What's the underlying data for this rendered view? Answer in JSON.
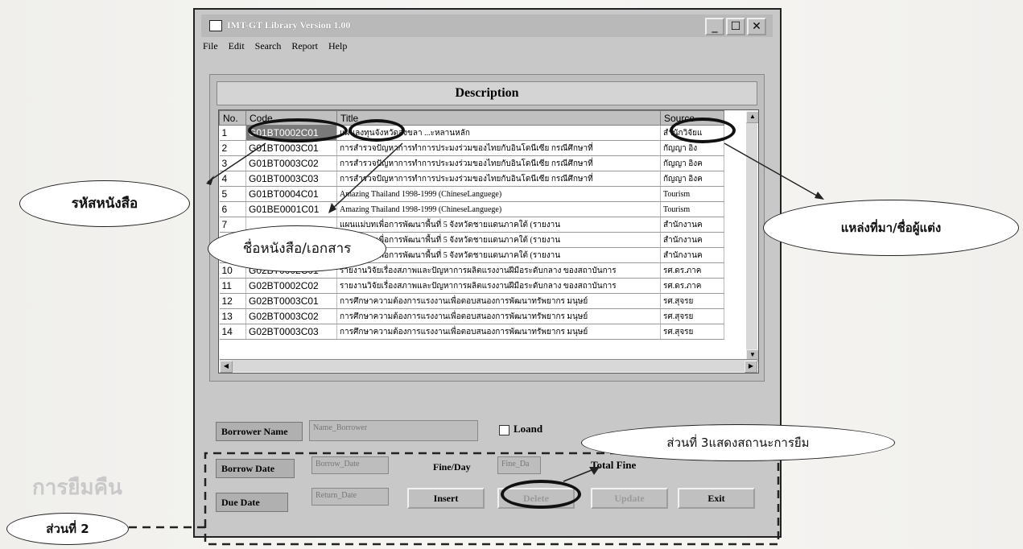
{
  "window": {
    "title": "IMT-GT Library Version 1.00",
    "controls": {
      "minimize": "_",
      "maximize": "☐",
      "close": "✕"
    }
  },
  "menu": [
    "File",
    "Edit",
    "Search",
    "Report",
    "Help"
  ],
  "panel": {
    "header": "Description",
    "columns": [
      "No.",
      "Code",
      "Title",
      "Source"
    ],
    "rows": [
      {
        "no": "1",
        "code": "G01BT0002C01",
        "title": "แผนลงทุนจังหวัดสงขลา  ...ะหลานหลัก",
        "source": "สำนักวิจัยแ"
      },
      {
        "no": "2",
        "code": "G01BT0003C01",
        "title": "การสำรวจปัญหาการทำการประมงร่วมของไทยกับอินโดนีเซีย กรณีศึกษาที่",
        "source": "กัญญา อิง"
      },
      {
        "no": "3",
        "code": "G01BT0003C02",
        "title": "การสำรวจปัญหาการทำการประมงร่วมของไทยกับอินโดนีเซีย กรณีศึกษาที่",
        "source": "กัญญา อิงค"
      },
      {
        "no": "4",
        "code": "G01BT0003C03",
        "title": "การสำรวจปัญหาการทำการประมงร่วมของไทยกับอินโดนีเซีย กรณีศึกษาที่",
        "source": "กัญญา อิงค"
      },
      {
        "no": "5",
        "code": "G01BT0004C01",
        "title": "Amazing Thailand 1998-1999 (ChineseLanguege)",
        "source": "Tourism"
      },
      {
        "no": "6",
        "code": "G01BE0001C01",
        "title": "Amazing Thailand 1998-1999 (ChineseLanguege)",
        "source": "Tourism"
      },
      {
        "no": "7",
        "code": "",
        "title": "แผนแม่บทเพื่อการพัฒนาพื้นที่ 5 จังหวัดชายแดนภาคใต้ (รายงาน",
        "source": "สำนักงานค"
      },
      {
        "no": "8",
        "code": "",
        "title": "แผนแม่บทเพื่อการพัฒนาพื้นที่ 5 จังหวัดชายแดนภาคใต้ (รายงาน",
        "source": "สำนักงานค"
      },
      {
        "no": "9",
        "code": "",
        "title": "แผนแม่บทเพื่อการพัฒนาพื้นที่ 5 จังหวัดชายแดนภาคใต้ (รายงาน",
        "source": "สำนักงานค"
      },
      {
        "no": "10",
        "code": "G02BT0002C01",
        "title": "รายงานวิจัยเรื่องสภาพและปัญหาการผลิตแรงงานฝีมือระดับกลาง ของสถาบันการ",
        "source": "รศ.ดร.ภาค"
      },
      {
        "no": "11",
        "code": "G02BT0002C02",
        "title": "รายงานวิจัยเรื่องสภาพและปัญหาการผลิตแรงงานฝีมือระดับกลาง ของสถาบันการ",
        "source": "รศ.ดร.ภาค"
      },
      {
        "no": "12",
        "code": "G02BT0003C01",
        "title": "การศึกษาความต้องการแรงงานเพื่อตอบสนองการพัฒนาทรัพยากร มนุษย์",
        "source": "รศ.สุจรย"
      },
      {
        "no": "13",
        "code": "G02BT0003C02",
        "title": "การศึกษาความต้องการแรงงานเพื่อตอบสนองการพัฒนาทรัพยากร มนุษย์",
        "source": "รศ.สุจรย"
      },
      {
        "no": "14",
        "code": "G02BT0003C03",
        "title": "การศึกษาความต้องการแรงงานเพื่อตอบสนองการพัฒนาทรัพยากร มนุษย์",
        "source": "รศ.สุจรย"
      }
    ]
  },
  "form": {
    "borrower_label": "Borrower Name",
    "borrower_value": "Name_Borrower",
    "loaned_label": "Loand",
    "borrow_date_label": "Borrow Date",
    "borrow_date_value": "Borrow_Date",
    "fine_label": "Fine/Day",
    "fine_value": "Fine_Da",
    "total_label": "Total Fine",
    "due_date_label": "Due Date",
    "due_date_value": "Return_Date",
    "buttons": {
      "insert": "Insert",
      "delete": "Delete",
      "update": "Update",
      "exit": "Exit"
    }
  },
  "annotations": {
    "book_code": "รหัสหนังสือ",
    "book_title": "ชื่อหนังสือ/เอกสาร",
    "source_author": "แหล่งที่มา/ชื่อผู้แต่ง",
    "part3": "ส่วนที่ 3แสดงสถานะการยืม",
    "part2": "ส่วนที่ 2",
    "bg_text": "การยืมคืน"
  }
}
